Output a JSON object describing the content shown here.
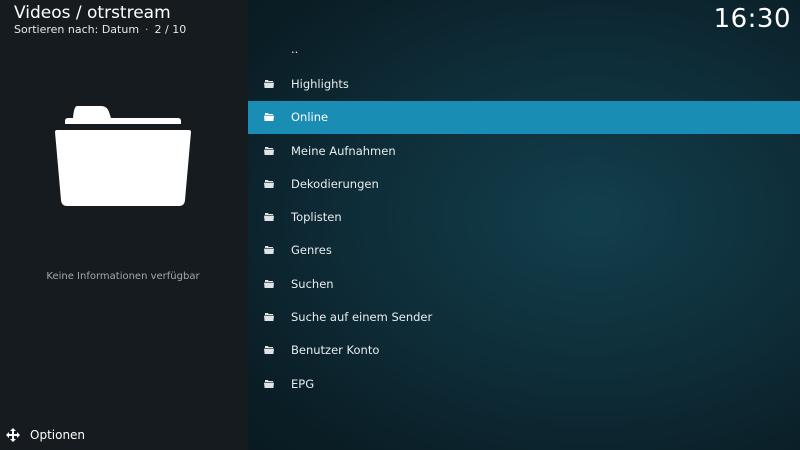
{
  "header": {
    "title": "Videos / otrstream",
    "sort_label": "Sortieren nach: Datum",
    "separator": "·",
    "position": "2 / 10",
    "clock": "16:30"
  },
  "info_panel": {
    "icon": "folder-icon",
    "no_info_text": "Keine Informationen verfügbar"
  },
  "footer": {
    "options_icon": "options-arrows-icon",
    "options_label": "Optionen"
  },
  "list": {
    "selected_index": 2,
    "accent_color": "#1a8db4",
    "items": [
      {
        "label": "..",
        "icon": null
      },
      {
        "label": "Highlights",
        "icon": "folder-icon"
      },
      {
        "label": "Online",
        "icon": "folder-icon"
      },
      {
        "label": "Meine Aufnahmen",
        "icon": "folder-icon"
      },
      {
        "label": "Dekodierungen",
        "icon": "folder-icon"
      },
      {
        "label": "Toplisten",
        "icon": "folder-icon"
      },
      {
        "label": "Genres",
        "icon": "folder-icon"
      },
      {
        "label": "Suchen",
        "icon": "folder-icon"
      },
      {
        "label": "Suche auf einem Sender",
        "icon": "folder-icon"
      },
      {
        "label": "Benutzer Konto",
        "icon": "folder-icon"
      },
      {
        "label": "EPG",
        "icon": "folder-icon"
      }
    ]
  }
}
